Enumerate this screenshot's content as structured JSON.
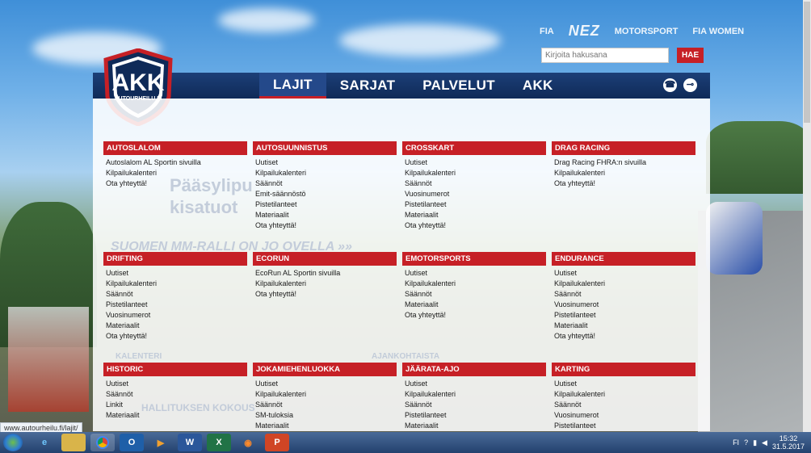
{
  "header": {
    "partners": [
      "FIA",
      "NEZ",
      "MOTORSPORT",
      "FIA WOMEN"
    ],
    "search_placeholder": "Kirjoita hakusana",
    "search_button": "HAE",
    "logo_text": "AKK",
    "logo_sub": "AUTOURHEILU.FI"
  },
  "nav": {
    "items": [
      "LAJIT",
      "SARJAT",
      "PALVELUT",
      "AKK"
    ],
    "active": "LAJIT"
  },
  "categories": [
    {
      "title": "AUTOSLALOM",
      "links": [
        "Autoslalom AL Sportin sivuilla",
        "Kilpailukalenteri",
        "Ota yhteyttä!"
      ]
    },
    {
      "title": "AUTOSUUNNISTUS",
      "links": [
        "Uutiset",
        "Kilpailukalenteri",
        "Säännöt",
        "Emit-säännöstö",
        "Pistetilanteet",
        "Materiaalit",
        "Ota yhteyttä!"
      ]
    },
    {
      "title": "CROSSKART",
      "links": [
        "Uutiset",
        "Kilpailukalenteri",
        "Säännöt",
        "Vuosinumerot",
        "Pistetilanteet",
        "Materiaalit",
        "Ota yhteyttä!"
      ]
    },
    {
      "title": "DRAG RACING",
      "links": [
        "Drag Racing FHRA:n sivuilla",
        "Kilpailukalenteri",
        "Ota yhteyttä!"
      ]
    },
    {
      "title": "DRIFTING",
      "links": [
        "Uutiset",
        "Kilpailukalenteri",
        "Säännöt",
        "Pistetilanteet",
        "Vuosinumerot",
        "Materiaalit",
        "Ota yhteyttä!"
      ]
    },
    {
      "title": "ECORUN",
      "links": [
        "EcoRun AL Sportin sivuilla",
        "Kilpailukalenteri",
        "Ota yhteyttä!"
      ]
    },
    {
      "title": "EMOTORSPORTS",
      "links": [
        "Uutiset",
        "Kilpailukalenteri",
        "Säännöt",
        "Materiaalit",
        "Ota yhteyttä!"
      ]
    },
    {
      "title": "ENDURANCE",
      "links": [
        "Uutiset",
        "Kilpailukalenteri",
        "Säännöt",
        "Vuosinumerot",
        "Pistetilanteet",
        "Materiaalit",
        "Ota yhteyttä!"
      ]
    },
    {
      "title": "HISTORIC",
      "links": [
        "Uutiset",
        "Säännöt",
        "Linkit",
        "Materiaalit"
      ]
    },
    {
      "title": "JOKAMIEHENLUOKKA",
      "links": [
        "Uutiset",
        "Kilpailukalenteri",
        "Säännöt",
        "SM-tuloksia",
        "Materiaalit"
      ]
    },
    {
      "title": "JÄÄRATA-AJO",
      "links": [
        "Uutiset",
        "Kilpailukalenteri",
        "Säännöt",
        "Pistetilanteet",
        "Materiaalit"
      ]
    },
    {
      "title": "KARTING",
      "links": [
        "Uutiset",
        "Kilpailukalenteri",
        "Säännöt",
        "Vuosinumerot",
        "Pistetilanteet"
      ]
    }
  ],
  "background_text": {
    "promo1": "Pääsylipu",
    "promo2": "kisatuot",
    "banner": "SUOMEN MM-RALLI ON JO OVELLA »»",
    "kalenteri": "KALENTERI",
    "ajankohtaista": "AJANKOHTAISTA",
    "hallitus": "HALLITUKSEN KOKOUS"
  },
  "status_url": "www.autourheilu.fi/lajit/",
  "taskbar": {
    "apps": [
      "IE",
      "Explorer",
      "Chrome",
      "Outlook",
      "Media",
      "Word",
      "Excel",
      "Firefox",
      "PowerPoint"
    ],
    "lang": "FI",
    "time": "15:32",
    "date": "31.5.2017"
  },
  "colors": {
    "accent": "#c62026",
    "nav": "#0f2a58"
  }
}
